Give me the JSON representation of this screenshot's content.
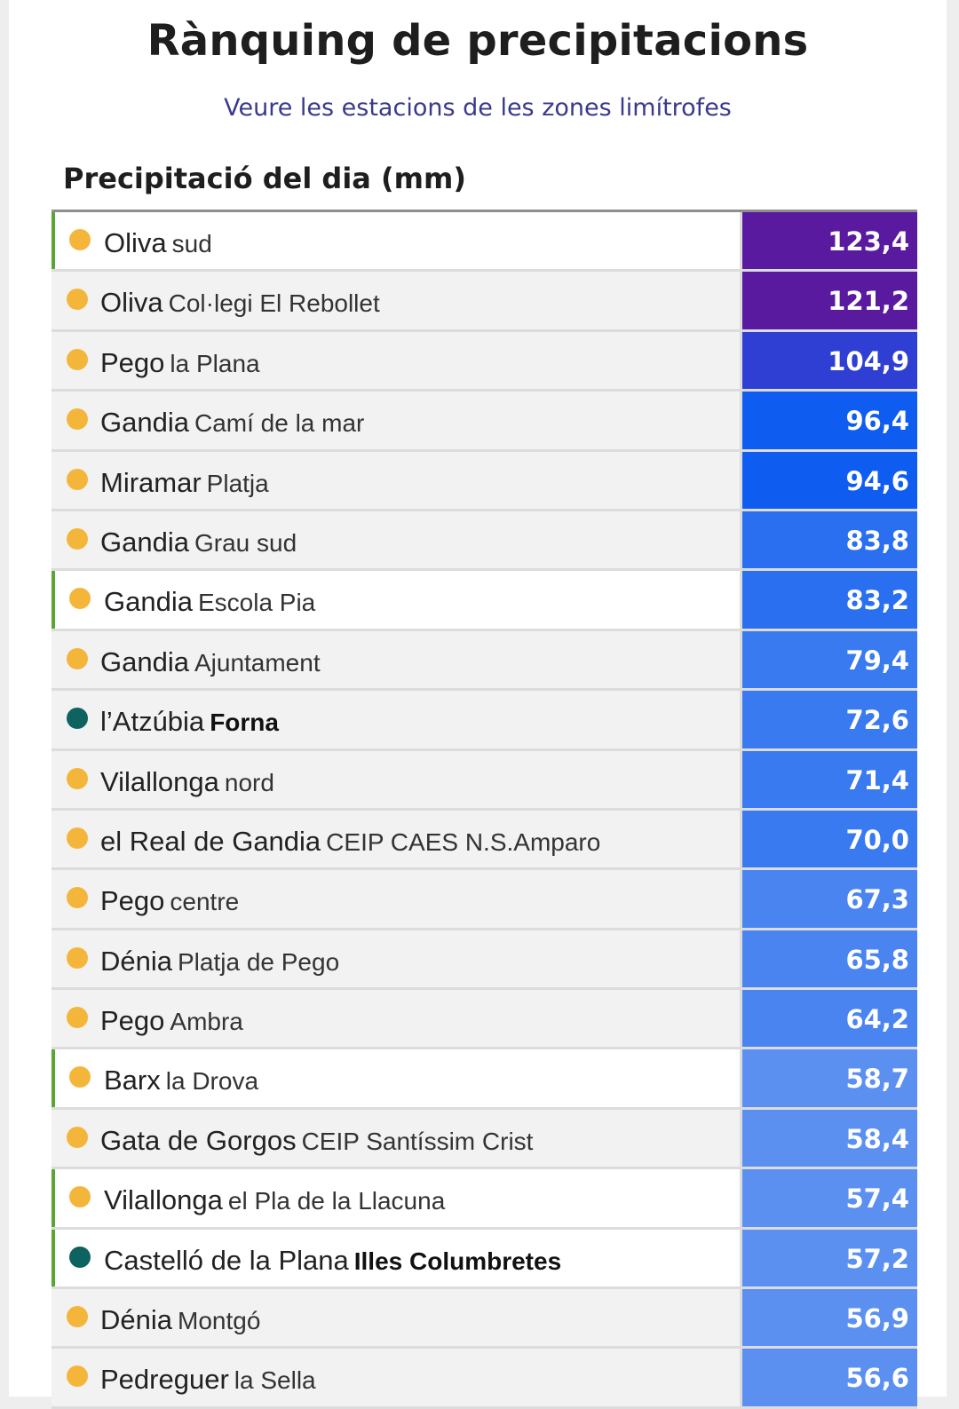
{
  "header": {
    "title": "Rànquing de precipitacions",
    "link": "Veure les estacions de les zones limítrofes"
  },
  "section": {
    "heading": "Precipitació del dia (mm)"
  },
  "stations": [
    {
      "town": "Oliva",
      "place": "sud",
      "value": "123,4",
      "highlight": true,
      "dot": "orange",
      "place_bold": false,
      "color": "#5a1aa0"
    },
    {
      "town": "Oliva",
      "place": "Col·legi El Rebollet",
      "value": "121,2",
      "highlight": false,
      "dot": "orange",
      "place_bold": false,
      "color": "#5a1aa0"
    },
    {
      "town": "Pego",
      "place": "la Plana",
      "value": "104,9",
      "highlight": false,
      "dot": "orange",
      "place_bold": false,
      "color": "#2f3fd3"
    },
    {
      "town": "Gandia",
      "place": "Camí de la mar",
      "value": "96,4",
      "highlight": false,
      "dot": "orange",
      "place_bold": false,
      "color": "#0f5df0"
    },
    {
      "town": "Miramar",
      "place": "Platja",
      "value": "94,6",
      "highlight": false,
      "dot": "orange",
      "place_bold": false,
      "color": "#0f5df0"
    },
    {
      "town": "Gandia",
      "place": "Grau sud",
      "value": "83,8",
      "highlight": false,
      "dot": "orange",
      "place_bold": false,
      "color": "#2a6ff0"
    },
    {
      "town": "Gandia",
      "place": "Escola Pia",
      "value": "83,2",
      "highlight": true,
      "dot": "orange",
      "place_bold": false,
      "color": "#2a6ff0"
    },
    {
      "town": "Gandia",
      "place": "Ajuntament",
      "value": "79,4",
      "highlight": false,
      "dot": "orange",
      "place_bold": false,
      "color": "#3a7af0"
    },
    {
      "town": "l’Atzúbia",
      "place": "Forna",
      "value": "72,6",
      "highlight": false,
      "dot": "teal",
      "place_bold": true,
      "color": "#3a7af0"
    },
    {
      "town": "Vilallonga",
      "place": "nord",
      "value": "71,4",
      "highlight": false,
      "dot": "orange",
      "place_bold": false,
      "color": "#3a7af0"
    },
    {
      "town": "el Real de Gandia",
      "place": "CEIP CAES N.S.Amparo",
      "value": "70,0",
      "highlight": false,
      "dot": "orange",
      "place_bold": false,
      "color": "#3a7af0"
    },
    {
      "town": "Pego",
      "place": "centre",
      "value": "67,3",
      "highlight": false,
      "dot": "orange",
      "place_bold": false,
      "color": "#4a84f0"
    },
    {
      "town": "Dénia",
      "place": "Platja de Pego",
      "value": "65,8",
      "highlight": false,
      "dot": "orange",
      "place_bold": false,
      "color": "#4a84f0"
    },
    {
      "town": "Pego",
      "place": "Ambra",
      "value": "64,2",
      "highlight": false,
      "dot": "orange",
      "place_bold": false,
      "color": "#4a84f0"
    },
    {
      "town": "Barx",
      "place": "la Drova",
      "value": "58,7",
      "highlight": true,
      "dot": "orange",
      "place_bold": false,
      "color": "#5c90f0"
    },
    {
      "town": "Gata de Gorgos",
      "place": "CEIP Santíssim Crist",
      "value": "58,4",
      "highlight": false,
      "dot": "orange",
      "place_bold": false,
      "color": "#5c90f0"
    },
    {
      "town": "Vilallonga",
      "place": "el Pla de la Llacuna",
      "value": "57,4",
      "highlight": true,
      "dot": "orange",
      "place_bold": false,
      "color": "#5c90f0"
    },
    {
      "town": "Castelló de la Plana",
      "place": "Illes Columbretes",
      "value": "57,2",
      "highlight": true,
      "dot": "teal",
      "place_bold": true,
      "color": "#5c90f0"
    },
    {
      "town": "Dénia",
      "place": "Montgó",
      "value": "56,9",
      "highlight": false,
      "dot": "orange",
      "place_bold": false,
      "color": "#5c90f0"
    },
    {
      "town": "Pedreguer",
      "place": "la Sella",
      "value": "56,6",
      "highlight": false,
      "dot": "orange",
      "place_bold": false,
      "color": "#5c90f0"
    }
  ]
}
